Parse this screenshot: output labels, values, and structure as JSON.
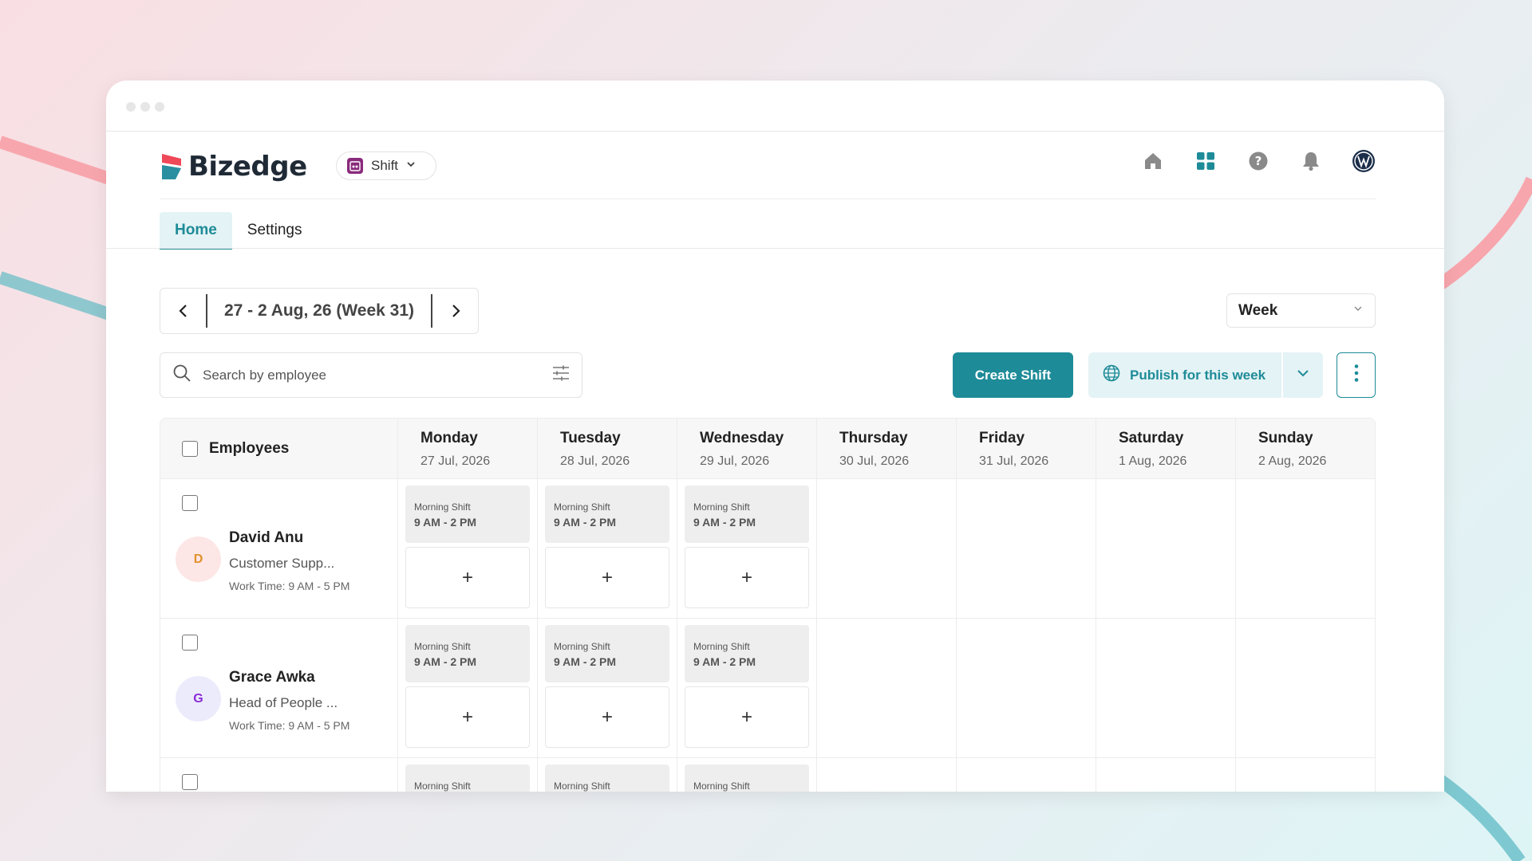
{
  "brand": {
    "name": "Bizedge",
    "accent": "#1e8b98",
    "logo_colors": [
      "#ef4858",
      "#2a8fa0"
    ]
  },
  "module_selector": {
    "label": "Shift",
    "icon": "calendar-people-icon"
  },
  "header_icons": [
    "home-icon",
    "apps-grid-icon",
    "help-icon",
    "bell-icon",
    "user-avatar-icon"
  ],
  "tabs": [
    {
      "label": "Home",
      "active": true
    },
    {
      "label": "Settings",
      "active": false
    }
  ],
  "week_nav": {
    "label": "27 - 2 Aug, 26 (Week 31)"
  },
  "view_select": {
    "label": "Week"
  },
  "search": {
    "placeholder": "Search by employee"
  },
  "actions": {
    "create_label": "Create Shift",
    "publish_label": "Publish for this week"
  },
  "schedule": {
    "employees_header": "Employees",
    "days": [
      {
        "name": "Monday",
        "date": "27 Jul, 2026"
      },
      {
        "name": "Tuesday",
        "date": "28 Jul, 2026"
      },
      {
        "name": "Wednesday",
        "date": "29 Jul, 2026"
      },
      {
        "name": "Thursday",
        "date": "30 Jul, 2026"
      },
      {
        "name": "Friday",
        "date": "31 Jul, 2026"
      },
      {
        "name": "Saturday",
        "date": "1 Aug, 2026"
      },
      {
        "name": "Sunday",
        "date": "2 Aug, 2026"
      }
    ],
    "rows": [
      {
        "initial": "D",
        "name": "David Anu",
        "role": "Customer Supp...",
        "work_time": "Work Time: 9 AM - 5 PM",
        "avatar_bg": "#fde6e6",
        "avatar_fg": "#e0922b",
        "shifts": [
          {
            "name": "Morning Shift",
            "time": "9 AM - 2 PM"
          },
          {
            "name": "Morning Shift",
            "time": "9 AM - 2 PM"
          },
          {
            "name": "Morning Shift",
            "time": "9 AM - 2 PM"
          }
        ]
      },
      {
        "initial": "G",
        "name": "Grace Awka",
        "role": "Head of People ...",
        "work_time": "Work Time: 9 AM - 5 PM",
        "avatar_bg": "#ecebfb",
        "avatar_fg": "#8a2bd6",
        "shifts": [
          {
            "name": "Morning Shift",
            "time": "9 AM - 2 PM"
          },
          {
            "name": "Morning Shift",
            "time": "9 AM - 2 PM"
          },
          {
            "name": "Morning Shift",
            "time": "9 AM - 2 PM"
          }
        ]
      },
      {
        "initial": "",
        "name": "",
        "role": "",
        "work_time": "",
        "avatar_bg": "#ffffff",
        "avatar_fg": "#ffffff",
        "shifts": [
          {
            "name": "Morning Shift",
            "time": ""
          },
          {
            "name": "Morning Shift",
            "time": ""
          },
          {
            "name": "Morning Shift",
            "time": ""
          }
        ]
      }
    ],
    "add_symbol": "+"
  }
}
